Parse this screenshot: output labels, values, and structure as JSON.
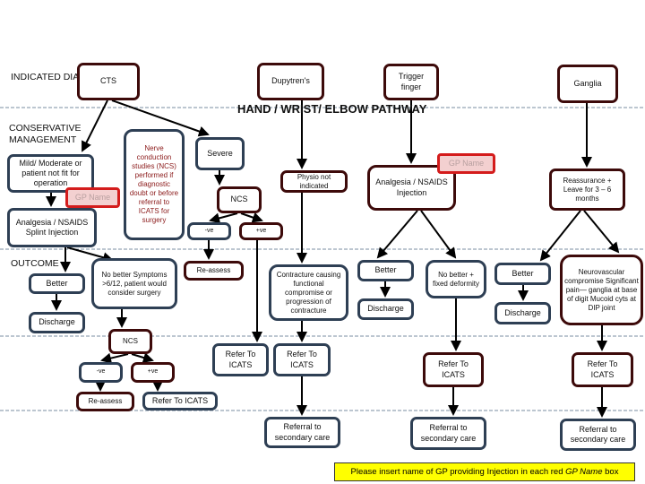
{
  "labels": {
    "indicated": "INDICATED DIAGNOSIS",
    "conservative": "CONSERVATIVE MANAGEMENT",
    "outcome": "OUTCOME",
    "title": "HAND / WRIST/ ELBOW PATHWAY"
  },
  "diagnoses": {
    "cts": "CTS",
    "dupuytren": "Dupytren's",
    "trigger": "Trigger finger",
    "ganglia": "Ganglia"
  },
  "cts": {
    "mild": "Mild/ Moderate or patient not fit for operation",
    "gp_name": "GP Name",
    "conservative": "Analgesia / NSAIDS Splint Injection",
    "ncs_note": "Nerve conduction studies (NCS) performed if diagnostic doubt or before referral to ICATS for surgery",
    "severe": "Severe",
    "ncs": "NCS",
    "neg": "-ve",
    "pos": "+ve",
    "reassess": "Re-assess",
    "better": "Better",
    "discharge": "Discharge",
    "no_better": "No better Symptoms >6/12, patient would consider surgery",
    "ncs2": "NCS",
    "neg2": "-ve",
    "pos2": "+ve",
    "reassess2": "Re-assess",
    "refer2": "Refer To ICATS",
    "refer": "Refer To ICATS"
  },
  "dupuytren": {
    "physio": "Physio not indicated",
    "contracture": "Contracture causing functional compromise or progression of contracture",
    "refer": "Refer To ICATS",
    "referral": "Referral to secondary care"
  },
  "trigger": {
    "treatment": "Analgesia / NSAIDS Injection",
    "gp_name": "GP Name",
    "better": "Better",
    "discharge": "Discharge",
    "no_better": "No better + fixed deformity",
    "refer": "Refer To ICATS",
    "referral": "Referral to secondary care"
  },
  "ganglia": {
    "treatment": "Reassurance + Leave for 3 – 6 months",
    "better": "Better",
    "discharge": "Discharge",
    "neuro": "Neurovascular compromise Significant pain— ganglia at base of digit Mucoid cyts at DIP joint",
    "refer": "Refer To ICATS",
    "referral": "Referral to secondary care"
  },
  "note": {
    "before": "Please insert name of GP providing Injection in each red ",
    "em": "GP Name",
    "after": " box"
  },
  "colors": {
    "navy_border": "#2e3f54",
    "maroon_border": "#3d0a0a",
    "gp_red": "#d41c1c",
    "note_yellow": "#ffff00"
  }
}
